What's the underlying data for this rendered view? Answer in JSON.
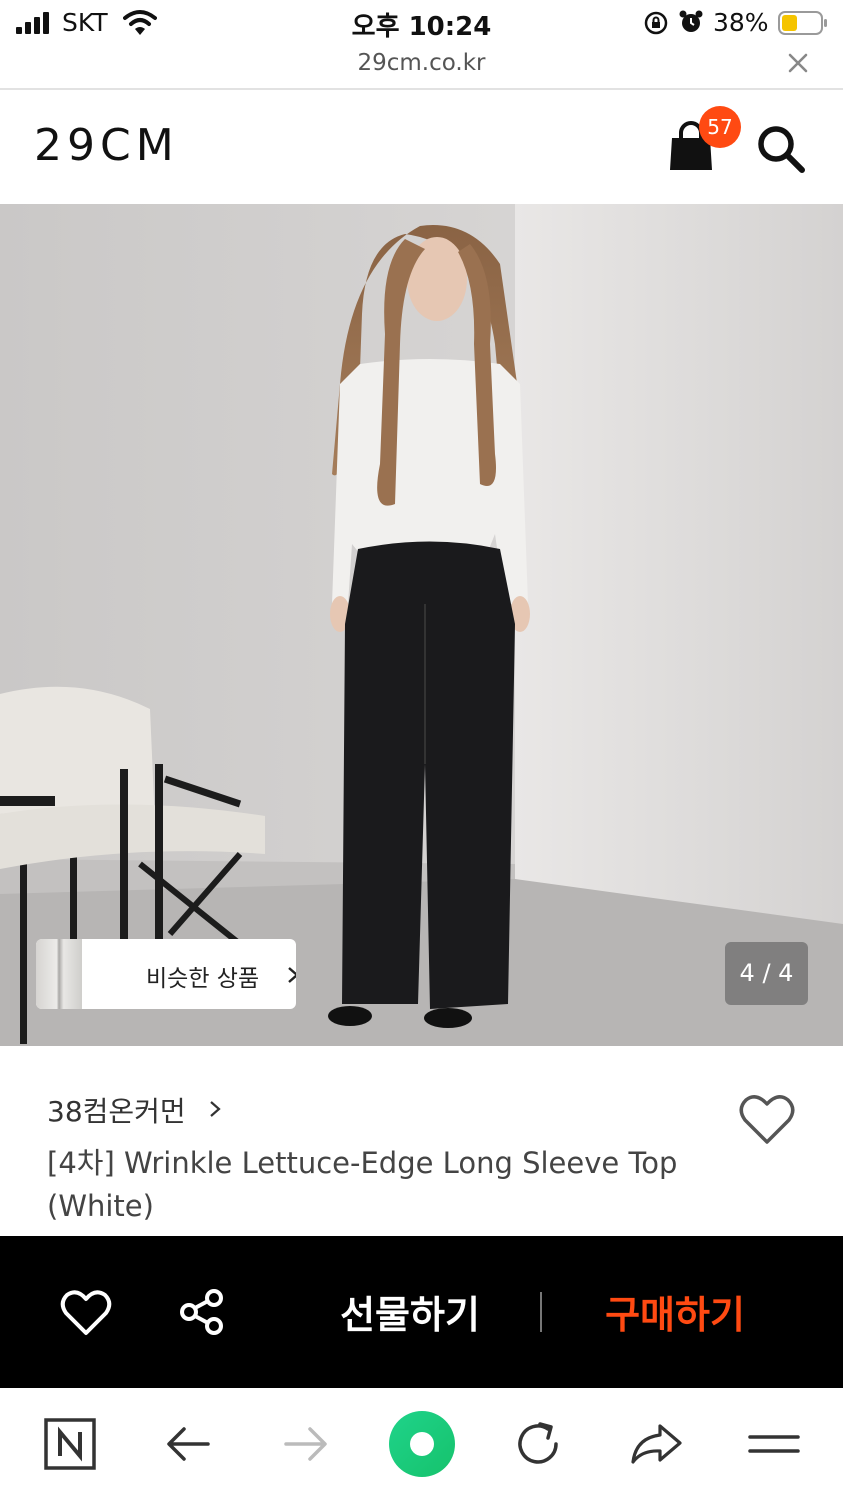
{
  "status_bar": {
    "carrier": "SKT",
    "time": "오후 10:24",
    "battery": "38%",
    "battery_color": "#f5c400"
  },
  "url_bar": {
    "domain": "29cm.co.kr"
  },
  "header": {
    "logo": "29CM",
    "cart_count": "57",
    "badge_color": "#ff4a12"
  },
  "gallery": {
    "similar_label": "비슷한 상품",
    "counter": "4 / 4"
  },
  "product": {
    "brand": "38컴온커먼",
    "title_line1": "[4차] Wrinkle Lettuce-Edge Long Sleeve Top",
    "title_line2": "(White)"
  },
  "action_bar": {
    "gift_label": "선물하기",
    "buy_label": "구매하기",
    "buy_color": "#ff4a12"
  },
  "toolbar": {
    "icons": [
      "naver-home-icon",
      "back-arrow-icon",
      "forward-arrow-icon",
      "green-dot-icon",
      "refresh-icon",
      "share-arrow-icon",
      "menu-icon"
    ]
  }
}
